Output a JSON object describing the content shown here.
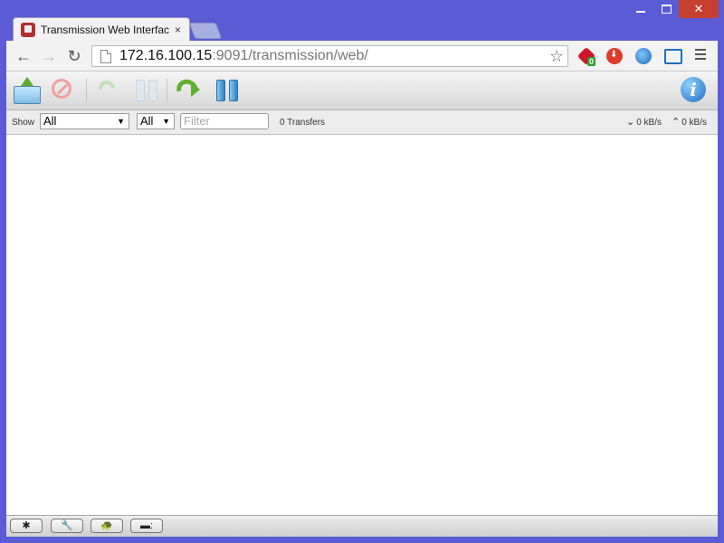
{
  "window": {
    "minimize_label": "",
    "maximize_label": "",
    "close_label": "✕"
  },
  "tab": {
    "title": "Transmission Web Interface",
    "close_label": "×"
  },
  "browser": {
    "url_host": "172.16.100.15",
    "url_rest": ":9091/transmission/web/",
    "adblock_badge": "0",
    "icons": [
      "back-arrow-icon",
      "forward-arrow-icon",
      "reload-icon",
      "page-icon",
      "star-icon",
      "adblock-icon",
      "download-icon",
      "globe-icon",
      "fullscreen-icon",
      "menu-icon"
    ]
  },
  "transmission": {
    "toolbar_icons": [
      "open-torrent-icon",
      "remove-torrent-icon",
      "resume-selected-icon",
      "pause-selected-icon",
      "resume-all-icon",
      "pause-all-icon",
      "inspector-info-icon"
    ],
    "inspector_glyph": "i",
    "filter": {
      "show_label": "Show",
      "state_value": "All",
      "tracker_value": "All",
      "placeholder": "Filter",
      "transfer_count": "0 Transfers",
      "download_speed": "0 kB/s",
      "upload_speed": "0 kB/s"
    },
    "bottom_buttons": [
      "settings-gear-icon",
      "preferences-wrench-icon",
      "turtle-speed-icon",
      "compact-view-icon"
    ],
    "bottom_glyphs": {
      "settings": "✱",
      "prefs": "🔧",
      "turtle": "🐢",
      "compact": "▬:"
    }
  },
  "colors": {
    "desktop": "#5b5bd6",
    "close_button": "#c6402f",
    "resume_green": "#62b033",
    "pause_blue": "#2a84c9"
  }
}
